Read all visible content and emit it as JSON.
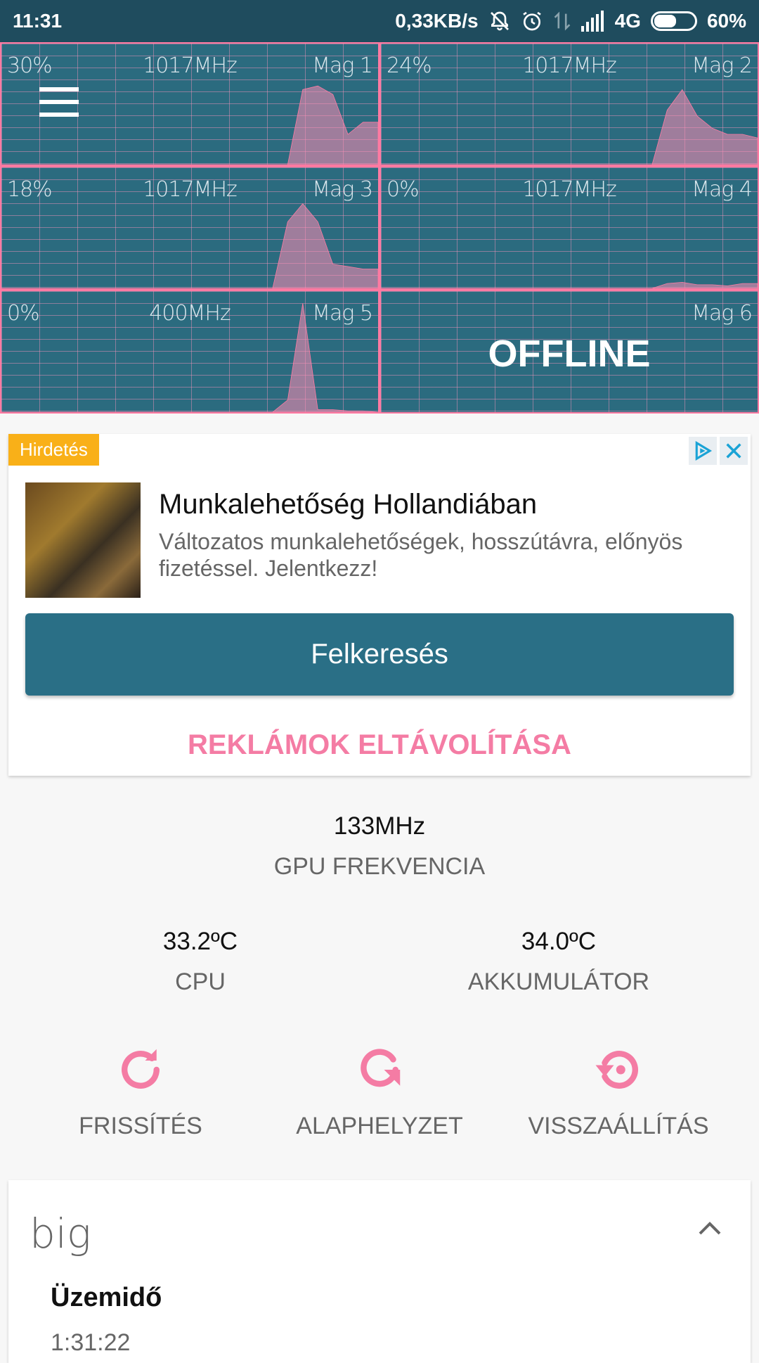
{
  "status_bar": {
    "time": "11:31",
    "net_speed": "0,33KB/s",
    "network": "4G",
    "battery": "60%",
    "battery_level": 0.6,
    "icons": [
      "notifications-off-icon",
      "alarm-icon",
      "data-transfer-icon",
      "signal-icon",
      "battery-icon"
    ]
  },
  "cores": [
    {
      "load": "30%",
      "freq": "1017MHz",
      "name": "Mag 1",
      "graph": [
        0,
        0,
        0,
        0,
        0,
        0,
        0,
        0,
        0,
        0,
        0,
        0,
        0,
        0,
        0,
        0,
        0,
        0,
        0,
        0,
        0.62,
        0.65,
        0.58,
        0.25,
        0.35,
        0.35
      ],
      "offline": false
    },
    {
      "load": "24%",
      "freq": "1017MHz",
      "name": "Mag 2",
      "graph": [
        0,
        0,
        0,
        0,
        0,
        0,
        0,
        0,
        0,
        0,
        0,
        0,
        0,
        0,
        0,
        0,
        0,
        0,
        0,
        0.45,
        0.62,
        0.4,
        0.3,
        0.25,
        0.25,
        0.22
      ],
      "offline": false
    },
    {
      "load": "18%",
      "freq": "1017MHz",
      "name": "Mag 3",
      "graph": [
        0,
        0,
        0,
        0,
        0,
        0,
        0,
        0,
        0,
        0,
        0,
        0,
        0,
        0,
        0,
        0,
        0,
        0,
        0,
        0.55,
        0.7,
        0.55,
        0.2,
        0.18,
        0.16,
        0.16
      ],
      "offline": false
    },
    {
      "load": "0%",
      "freq": "1017MHz",
      "name": "Mag 4",
      "graph": [
        0,
        0,
        0,
        0,
        0,
        0,
        0,
        0,
        0,
        0,
        0,
        0,
        0,
        0,
        0,
        0,
        0,
        0,
        0,
        0.04,
        0.05,
        0.03,
        0.03,
        0.02,
        0.04,
        0.04
      ],
      "offline": false
    },
    {
      "load": "0%",
      "freq": "400MHz",
      "name": "Mag 5",
      "graph": [
        0,
        0,
        0,
        0,
        0,
        0,
        0,
        0,
        0,
        0,
        0,
        0,
        0,
        0,
        0,
        0,
        0,
        0,
        0,
        0.1,
        0.9,
        0.02,
        0.02,
        0.01,
        0.01,
        0.0
      ],
      "offline": false
    },
    {
      "load": "",
      "freq": "",
      "name": "Mag 6",
      "graph": [],
      "offline": true,
      "offline_label": "OFFLINE"
    }
  ],
  "ad": {
    "label": "Hirdetés",
    "title": "Munkalehetőség Hollandiában",
    "description": "Változatos munkalehetőségek, hosszútávra, előnyös fizetéssel. Jelentkezz!",
    "cta": "Felkeresés",
    "remove_ads": "REKLÁMOK ELTÁVOLÍTÁSA"
  },
  "gpu": {
    "value": "133MHz",
    "label": "GPU FREKVENCIA"
  },
  "cpu_temp": {
    "value": "33.2ºC",
    "label": "CPU"
  },
  "battery_temp": {
    "value": "34.0ºC",
    "label": "AKKUMULÁTOR"
  },
  "actions": [
    {
      "label": "FRISSÍTÉS",
      "icon": "refresh-icon"
    },
    {
      "label": "ALAPHELYZET",
      "icon": "reset-icon"
    },
    {
      "label": "VISSZAÁLLÍTÁS",
      "icon": "restore-icon"
    }
  ],
  "cluster_card": {
    "title": "big",
    "uptime_label": "Üzemidő",
    "uptime_value": "1:31:22"
  },
  "colors": {
    "accent": "#f47ca4",
    "primary": "#2a6f86",
    "status_bar": "#1f4c5e"
  }
}
